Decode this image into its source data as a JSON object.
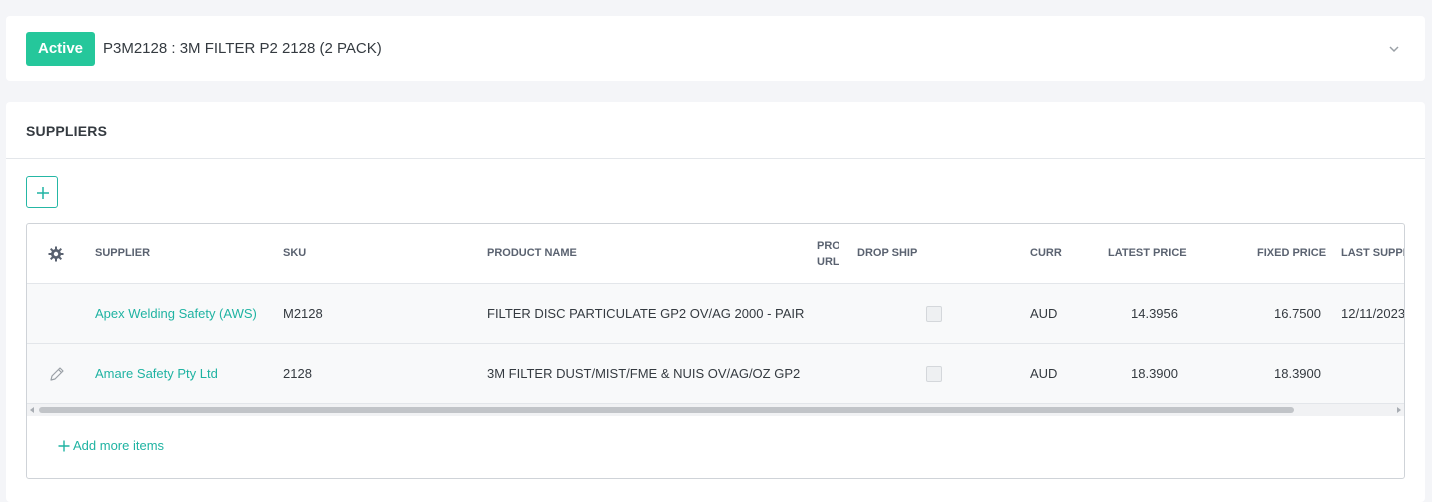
{
  "header": {
    "status": "Active",
    "title": "P3M2128 : 3M FILTER P2 2128 (2 PACK)",
    "expand_icon": "chevron-down-icon"
  },
  "suppliers": {
    "section_title": "SUPPLIERS",
    "add_button_icon": "plus-icon",
    "columns": {
      "settings_icon": "gear-icon",
      "supplier": "SUPPLIER",
      "sku": "SKU",
      "product_name": "PRODUCT NAME",
      "product_url": "PRODUCT URL",
      "drop_ship": "DROP SHIP",
      "curr": "CURR",
      "latest_price": "LATEST PRICE",
      "fixed_price": "FIXED PRICE",
      "last_supplied": "LAST SUPPLIED"
    },
    "rows": [
      {
        "supplier": "Apex Welding Safety (AWS)",
        "sku": "M2128",
        "product_name": "FILTER DISC PARTICULATE GP2 OV/AG 2000 - PAIR",
        "drop_ship": false,
        "curr": "AUD",
        "latest_price": "14.3956",
        "fixed_price": "16.7500",
        "last_supplied": "12/11/2023"
      },
      {
        "edit_icon": "pencil-icon",
        "supplier": "Amare Safety Pty Ltd",
        "sku": "2128",
        "product_name": "3M FILTER DUST/MIST/FME & NUIS OV/AG/OZ GP2",
        "drop_ship": false,
        "curr": "AUD",
        "latest_price": "18.3900",
        "fixed_price": "18.3900",
        "last_supplied": ""
      }
    ],
    "add_more_label": "Add more items"
  },
  "colors": {
    "accent": "#25c79b",
    "link": "#1fb3a2",
    "page_bg": "#f4f5f8"
  }
}
